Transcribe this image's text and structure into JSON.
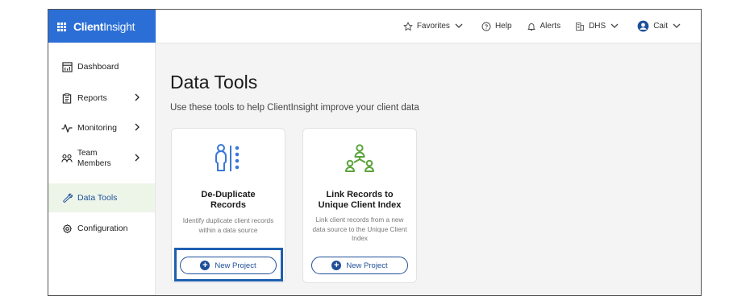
{
  "app": {
    "logo_bold": "Client",
    "logo_light": "Insight"
  },
  "topnav": {
    "favorites": "Favorites",
    "help": "Help",
    "alerts": "Alerts",
    "org": "DHS",
    "user": "Cait"
  },
  "sidebar": {
    "items": [
      {
        "label": "Dashboard"
      },
      {
        "label": "Reports"
      },
      {
        "label": "Monitoring"
      },
      {
        "label": "Team\nMembers"
      },
      {
        "label": "Data Tools"
      },
      {
        "label": "Configuration"
      }
    ]
  },
  "main": {
    "title": "Data Tools",
    "subtitle": "Use these tools to help ClientInsight improve your client data",
    "cards": [
      {
        "title": "De-Duplicate\nRecords",
        "description": "Identify duplicate client records within a data source",
        "button": "New Project"
      },
      {
        "title": "Link Records to\nUnique Client Index",
        "description": "Link client records from a new data source to the Unique Client Index",
        "button": "New Project"
      }
    ]
  },
  "colors": {
    "brand_blue": "#2b6fd6",
    "accent_navy": "#1f4f99",
    "icon_blue": "#3a78d8",
    "icon_green": "#5ba33b",
    "active_bg": "#edf5e9"
  }
}
